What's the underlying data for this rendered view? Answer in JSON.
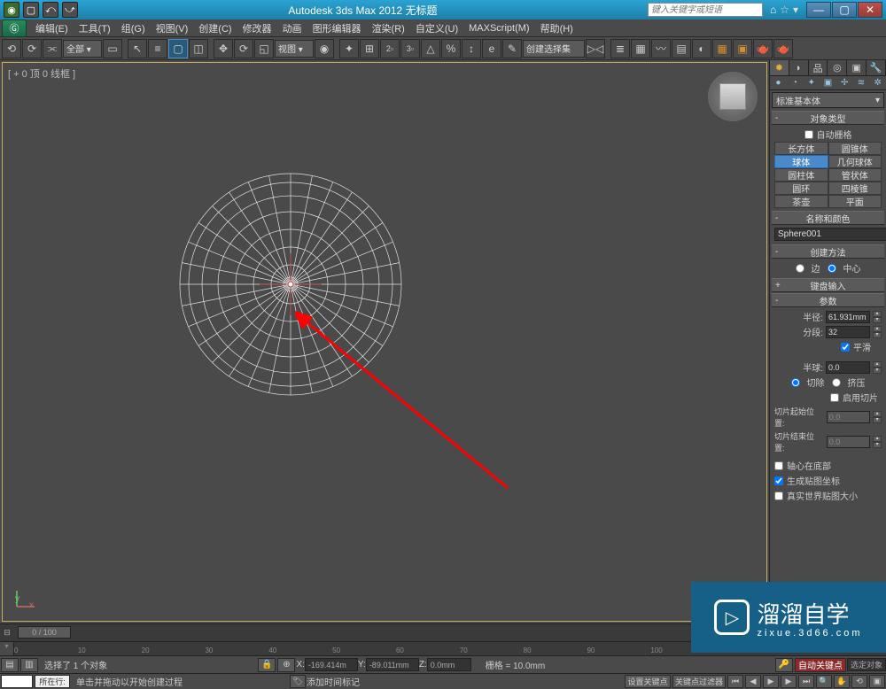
{
  "titlebar": {
    "title": "Autodesk 3ds Max  2012        无标题",
    "search_placeholder": "键入关键字或短语"
  },
  "menus": [
    "编辑(E)",
    "工具(T)",
    "组(G)",
    "视图(V)",
    "创建(C)",
    "修改器",
    "动画",
    "图形编辑器",
    "渲染(R)",
    "自定义(U)",
    "MAXScript(M)",
    "帮助(H)"
  ],
  "toolbar": {
    "layer_drop": "全部 ▾",
    "view_drop": "视图 ▾",
    "selset_drop": "创建选择集"
  },
  "viewport": {
    "label": "[ + 0 顶 0 线框 ]",
    "axis_x": "x",
    "axis_y": "y"
  },
  "panel": {
    "category": "标准基本体",
    "roll_objtype": "对象类型",
    "autogrid": "自动栅格",
    "prims": [
      "长方体",
      "圆锥体",
      "球体",
      "几何球体",
      "圆柱体",
      "管状体",
      "圆环",
      "四棱锥",
      "茶壶",
      "平面"
    ],
    "roll_namecolor": "名称和颜色",
    "objname": "Sphere001",
    "roll_method": "创建方法",
    "m_edge": "边",
    "m_center": "中心",
    "roll_kbd": "键盘输入",
    "roll_params": "参数",
    "p_radius": "半径:",
    "p_radius_v": "61.931mm",
    "p_segs": "分段:",
    "p_segs_v": "32",
    "p_smooth": "平滑",
    "p_hemi": "半球:",
    "p_hemi_v": "0.0",
    "p_chop": "切除",
    "p_squash": "挤压",
    "p_slice": "启用切片",
    "p_sfrom": "切片起始位置:",
    "p_sfrom_v": "0.0",
    "p_sto": "切片结束位置:",
    "p_sto_v": "0.0",
    "p_base": "轴心在底部",
    "p_gen": "生成贴图坐标",
    "p_rw": "真实世界贴图大小"
  },
  "time": {
    "slider": "0 / 100"
  },
  "status": {
    "sel": "选择了 1 个对象",
    "x": "X:",
    "xv": "-169.414m",
    "y": "Y:",
    "yv": "-89.011mm",
    "z": "Z:",
    "zv": "0.0mm",
    "grid": "栅格 = 10.0mm",
    "autokey": "自动关键点",
    "selset": "选定对象",
    "prompt": "单击并拖动以开始创建过程",
    "addtime": "添加时间标记",
    "setkey": "设置关键点",
    "kfilter": "关键点过滤器",
    "szh": "所在行:"
  },
  "watermark": {
    "brand": "溜溜自学",
    "url": "zixue.3d66.com"
  }
}
